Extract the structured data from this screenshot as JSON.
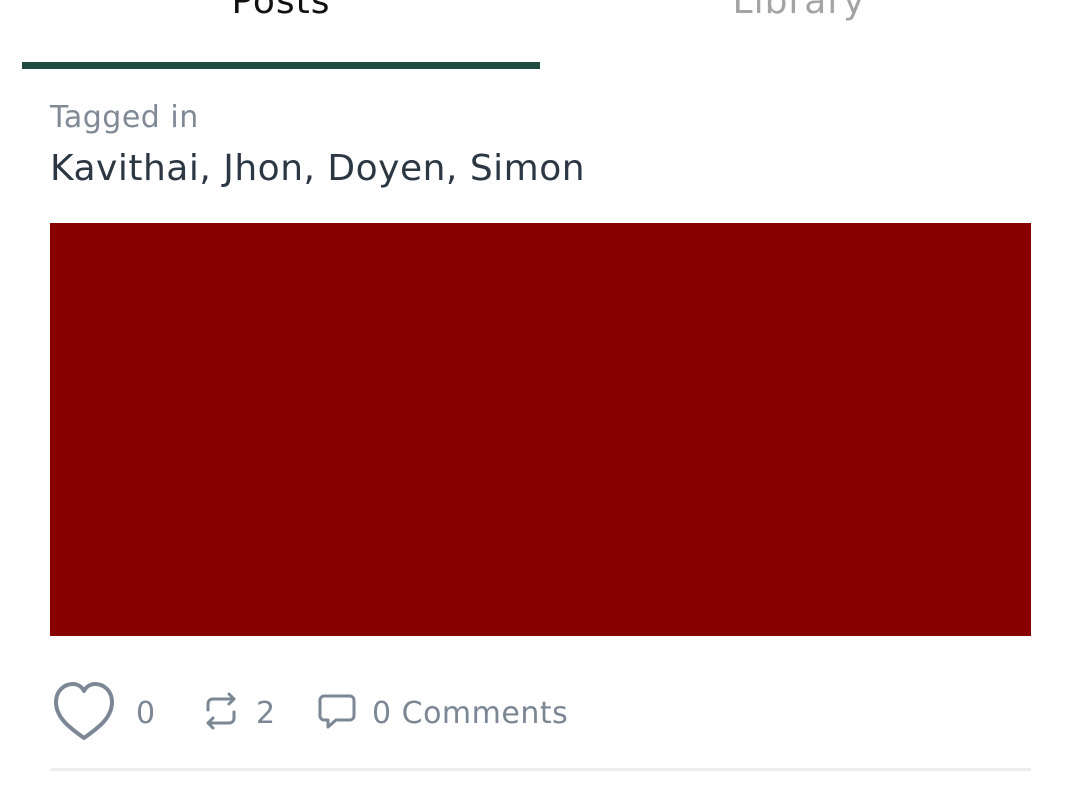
{
  "tabs": {
    "posts_label": "Posts",
    "library_label": "Library",
    "active_color": "#1f4a3f"
  },
  "tagged": {
    "caption": "Tagged in",
    "names": [
      "Kavithai",
      "Jhon",
      "Doyen",
      "Simon"
    ]
  },
  "media": {
    "color": "#880000"
  },
  "actions": {
    "like_icon": "heart-icon",
    "like_count": "0",
    "share_icon": "repost-icon",
    "share_count": "2",
    "comment_icon": "comment-bubble-icon",
    "comments_label": "0 Comments"
  }
}
